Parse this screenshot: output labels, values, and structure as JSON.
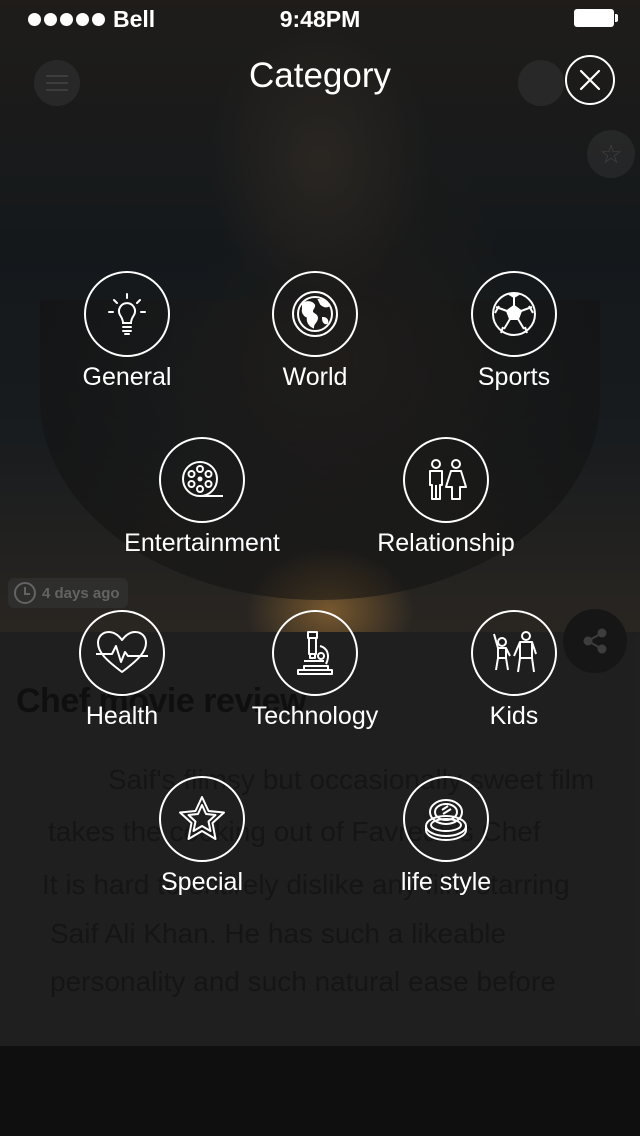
{
  "status_bar": {
    "carrier": "Bell",
    "time": "9:48PM"
  },
  "header": {
    "title": "Category"
  },
  "categories": [
    {
      "label": "General",
      "icon": "lightbulb-icon"
    },
    {
      "label": "World",
      "icon": "globe-icon"
    },
    {
      "label": "Sports",
      "icon": "soccer-ball-icon"
    },
    {
      "label": "Entertainment",
      "icon": "film-reel-icon"
    },
    {
      "label": "Relationship",
      "icon": "couple-icon"
    },
    {
      "label": "Health",
      "icon": "heart-pulse-icon"
    },
    {
      "label": "Technology",
      "icon": "microscope-icon"
    },
    {
      "label": "Kids",
      "icon": "kids-icon"
    },
    {
      "label": "Special",
      "icon": "star-icon"
    },
    {
      "label": "life style",
      "icon": "compact-mirror-icon"
    }
  ],
  "background_article": {
    "timestamp": "4 days ago",
    "title": "Chef movie review",
    "lines": [
      "Saif's flimsy but occasionally sweet film",
      "takes the cooking out of Favreau's Chef",
      "It is hard to entirely dislike any film starring",
      "Saif Ali Khan. He has such a likeable",
      "personality and such natural ease before"
    ]
  }
}
